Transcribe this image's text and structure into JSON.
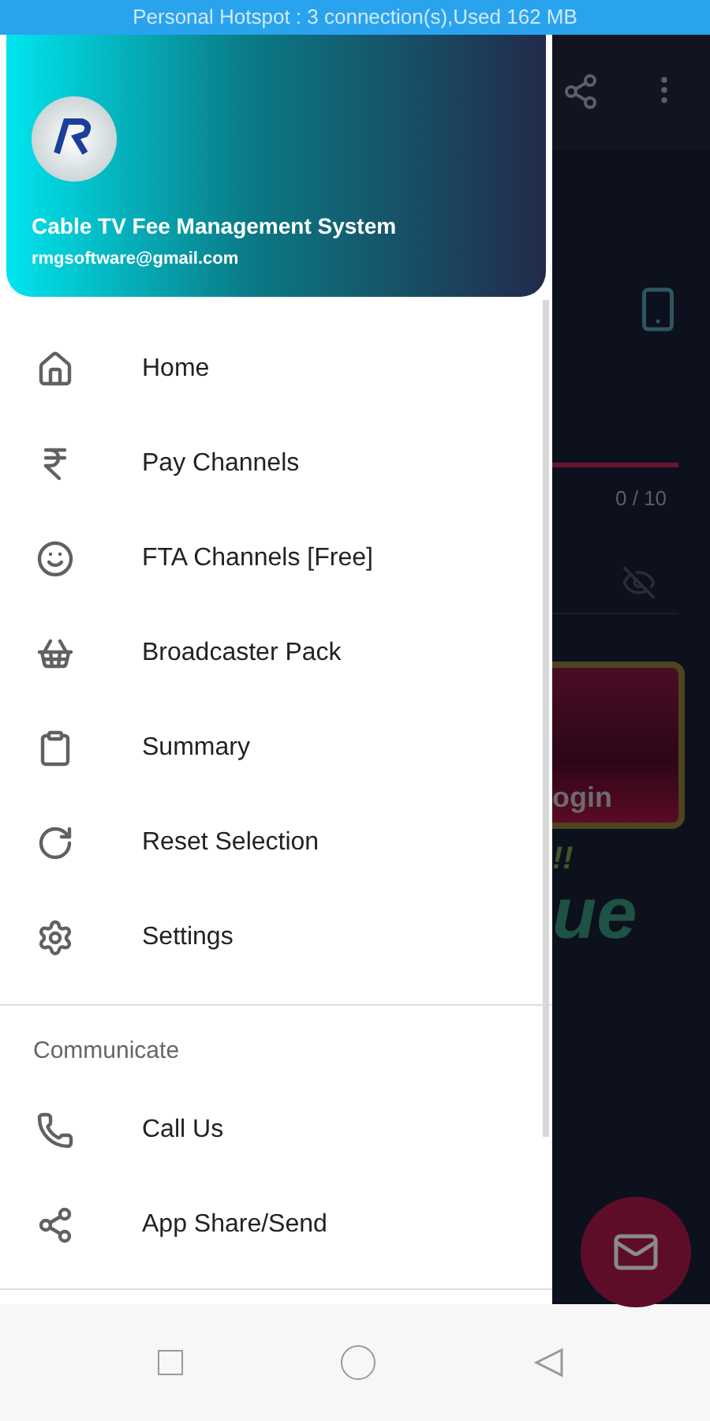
{
  "status_bar": {
    "text": "Personal Hotspot : 3 connection(s),Used  162 MB"
  },
  "drawer": {
    "header": {
      "title": "Cable TV Fee Management System",
      "email": "rmgsoftware@gmail.com"
    },
    "items": [
      {
        "label": "Home"
      },
      {
        "label": "Pay Channels"
      },
      {
        "label": "FTA Channels [Free]"
      },
      {
        "label": "Broadcaster Pack"
      },
      {
        "label": "Summary"
      },
      {
        "label": "Reset Selection"
      },
      {
        "label": "Settings"
      }
    ],
    "section": {
      "title": "Communicate",
      "items": [
        {
          "label": "Call Us"
        },
        {
          "label": "App Share/Send"
        }
      ]
    }
  },
  "background_app": {
    "counter": "0 / 10",
    "login_button": "ogin",
    "exclaim": "!!",
    "logo_text": "ue"
  }
}
